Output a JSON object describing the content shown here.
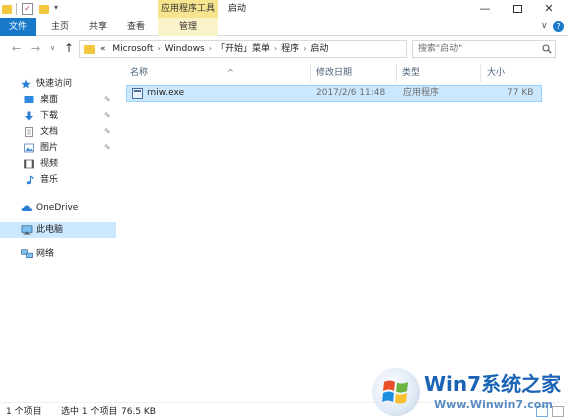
{
  "window": {
    "title": "启动",
    "contextual_group": "应用程序工具",
    "min_glyph": "—",
    "close_glyph": "✕"
  },
  "quick_access_toolbar": {
    "dropdown_glyph": "▾",
    "check_glyph": "✓"
  },
  "ribbon": {
    "tabs": [
      {
        "label": "文件",
        "active": true
      },
      {
        "label": "主页"
      },
      {
        "label": "共享"
      },
      {
        "label": "查看"
      },
      {
        "label": "管理",
        "contextual": true
      }
    ],
    "expand_glyph": "∨",
    "help_glyph": "?"
  },
  "navigation": {
    "back_glyph": "←",
    "forward_glyph": "→",
    "recent_glyph": "∨",
    "up_glyph": "↑",
    "refresh_glyph": "↻"
  },
  "address": {
    "overflow": "«",
    "separator": "›",
    "breadcrumbs": [
      "Microsoft",
      "Windows",
      "「开始」菜单",
      "程序",
      "启动"
    ],
    "dropdown_glyph": "∨"
  },
  "search": {
    "placeholder": "搜索\"启动\""
  },
  "sidebar": {
    "quick_access_label": "快速访问",
    "items": [
      {
        "label": "桌面",
        "icon": "desktop-icon",
        "pinned": true
      },
      {
        "label": "下载",
        "icon": "download-icon",
        "pinned": true
      },
      {
        "label": "文档",
        "icon": "document-icon",
        "pinned": true
      },
      {
        "label": "图片",
        "icon": "pictures-icon",
        "pinned": true
      },
      {
        "label": "视频",
        "icon": "videos-icon",
        "pinned": false
      },
      {
        "label": "音乐",
        "icon": "music-icon",
        "pinned": false
      }
    ],
    "pin_glyph": "✎",
    "onedrive_label": "OneDrive",
    "this_pc_label": "此电脑",
    "network_label": "网络"
  },
  "file_list": {
    "columns": [
      "名称",
      "修改日期",
      "类型",
      "大小"
    ],
    "sort_glyph": "^",
    "rows": [
      {
        "name": "rniw.exe",
        "modified": "2017/2/6 11:48",
        "type": "应用程序",
        "size": "77 KB",
        "selected": true
      }
    ]
  },
  "status_bar": {
    "item_count": "1 个项目",
    "selection": "选中 1 个项目",
    "selection_size": "76.5 KB"
  },
  "watermark": {
    "title": "Win7系统之家",
    "url": "Www.Winwin7.com"
  },
  "colors": {
    "accent": "#1979ca",
    "selection": "#cce8ff",
    "selection_border": "#99d1ff",
    "contextual_tab": "#f6e58e",
    "folder": "#f3c640"
  }
}
